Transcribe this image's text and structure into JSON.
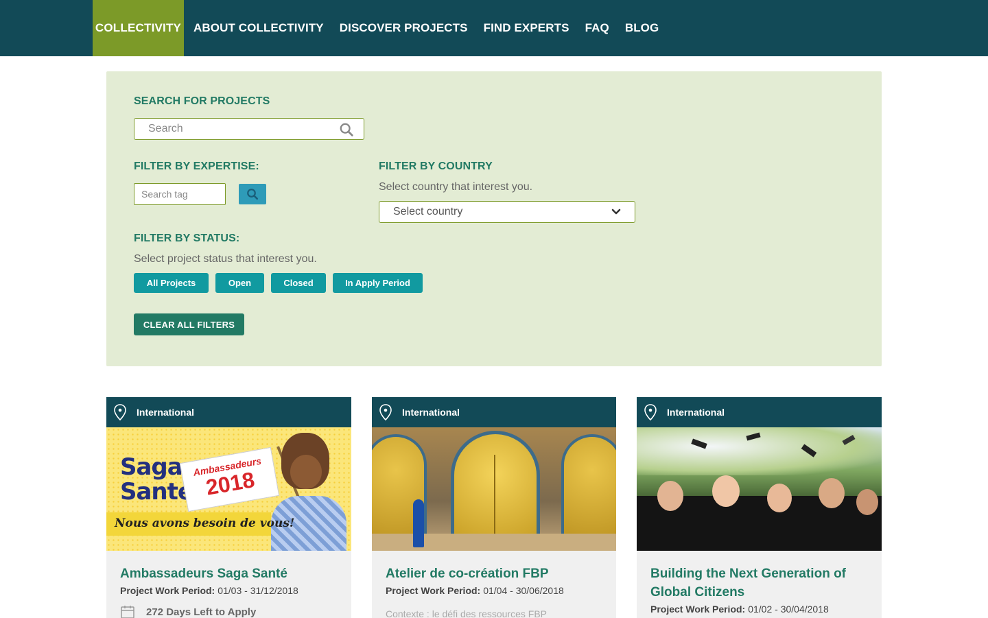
{
  "nav": {
    "brand": "COLLECTIVITY",
    "links": [
      "ABOUT COLLECTIVITY",
      "DISCOVER PROJECTS",
      "FIND EXPERTS",
      "FAQ",
      "BLOG"
    ]
  },
  "filters": {
    "search_heading": "SEARCH FOR PROJECTS",
    "search_placeholder": "Search",
    "expertise_heading": "FILTER BY EXPERTISE:",
    "tag_placeholder": "Search tag",
    "country_heading": "FILTER BY COUNTRY",
    "country_sub": "Select country that interest you.",
    "country_select": "Select country",
    "status_heading": "FILTER BY STATUS:",
    "status_sub": "Select project status that interest you.",
    "status_buttons": [
      "All Projects",
      "Open",
      "Closed",
      "In Apply Period"
    ],
    "clear_label": "CLEAR ALL FILTERS"
  },
  "cards": [
    {
      "location": "International",
      "image": "saga-sante-poster",
      "image_text": {
        "line1": "Saga",
        "line2": "Santé",
        "flag1": "Ambassadeurs",
        "flag2": "2018",
        "tagline": "Nous avons besoin de vous!"
      },
      "title": "Ambassadeurs Saga Santé",
      "period_label": "Project Work Period:",
      "period": "01/03 - 31/12/2018",
      "days_left": "272 Days Left to Apply"
    },
    {
      "location": "International",
      "image": "moroccan-golden-doors",
      "title": "Atelier de co-création FBP",
      "period_label": "Project Work Period:",
      "period": "01/04 - 30/06/2018",
      "extra": "Contexte : le défi des ressources FBP"
    },
    {
      "location": "International",
      "image": "graduates-throwing-caps",
      "title": "Building the Next Generation of Global Citizens",
      "period_label": "Project Work Period:",
      "period": "01/02 - 30/04/2018"
    }
  ],
  "colors": {
    "nav_bg": "#124a57",
    "brand_bg": "#7c9a28",
    "panel_bg": "#e3ecd4",
    "heading_green": "#227a64",
    "status_teal": "#119aa0",
    "tag_blue": "#2e9bb8"
  }
}
